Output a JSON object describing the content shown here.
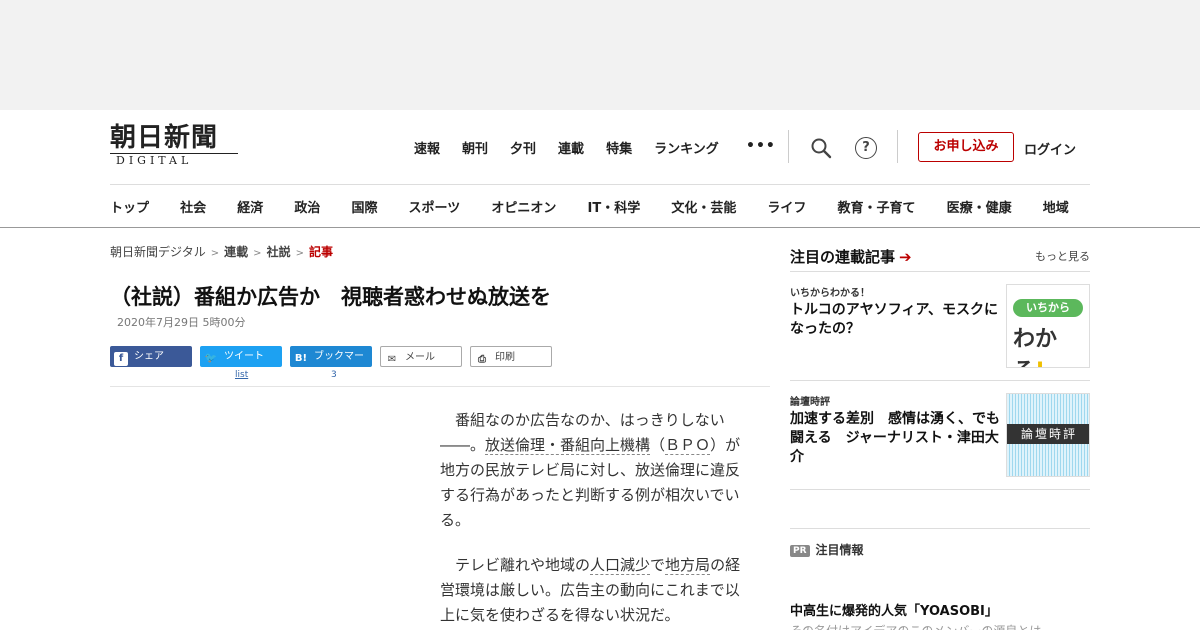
{
  "header": {
    "logo": {
      "main": "朝日新聞",
      "sub": "DIGITAL"
    },
    "top_nav": [
      "速報",
      "朝刊",
      "夕刊",
      "連載",
      "特集",
      "ランキング"
    ],
    "more_label": "•••",
    "help_label": "?",
    "apply_label": "お申し込み",
    "login_label": "ログイン",
    "accent_color": "#bb0000"
  },
  "category_nav": [
    "トップ",
    "社会",
    "経済",
    "政治",
    "国際",
    "スポーツ",
    "オピニオン",
    "IT・科学",
    "文化・芸能",
    "ライフ",
    "教育・子育て",
    "医療・健康",
    "地域"
  ],
  "breadcrumb": {
    "items": [
      "朝日新聞デジタル",
      "連載",
      "社説"
    ],
    "current": "記事",
    "separator": ">"
  },
  "article": {
    "title": "（社説）番組か広告か　視聴者惑わせぬ放送を",
    "date": "2020年7月29日 5時00分",
    "share": {
      "facebook": {
        "icon": "f",
        "label": "シェア"
      },
      "twitter": {
        "icon": "🐦",
        "label": "ツイート",
        "count": "list"
      },
      "hatena": {
        "icon": "B!",
        "label": "ブックマーク",
        "count": "3"
      },
      "mail": {
        "icon": "✉",
        "label": "メール"
      },
      "print": {
        "icon": "⎙",
        "label": "印刷"
      }
    },
    "paragraph1": {
      "pre": "番組なのか広告なのか、はっきりしない――。",
      "keyword1": "放送倫理・番組向上機構",
      "mid1": "（",
      "keyword2": "ＢＰＯ",
      "post": "）が地方の民放テレビ局に対し、放送倫理に違反する行為があったと判断する例が相次いでいる。"
    },
    "paragraph2": {
      "pre": "テレビ離れや地域の",
      "keyword1": "人口減少",
      "mid1": "で",
      "keyword2": "地方局",
      "post": "の経営環境は厳しい。広告主の動向にこれまで以上に気を使わざるを得ない状況だ。"
    }
  },
  "sidebar": {
    "title": "注目の連載記事",
    "arrow": "➔",
    "more_label": "もっと見る",
    "items": [
      {
        "label": "いちからわかる！",
        "text": "トルコのアヤソフィア、モスクになったの？",
        "thumb_pill": "いちから",
        "thumb_big": "わかる",
        "thumb_exc": "!"
      },
      {
        "label": "論壇時評",
        "text": "加速する差別　感情は湧く、でも闘える　ジャーナリスト・津田大介",
        "thumb_band": "論壇時評"
      }
    ]
  },
  "pr": {
    "badge": "PR",
    "title": "注目情報",
    "article": "中高生に爆発的人気「YOASOBI」",
    "cut_text": "その名付けアイデアのこのメンバーの源泉とは"
  }
}
